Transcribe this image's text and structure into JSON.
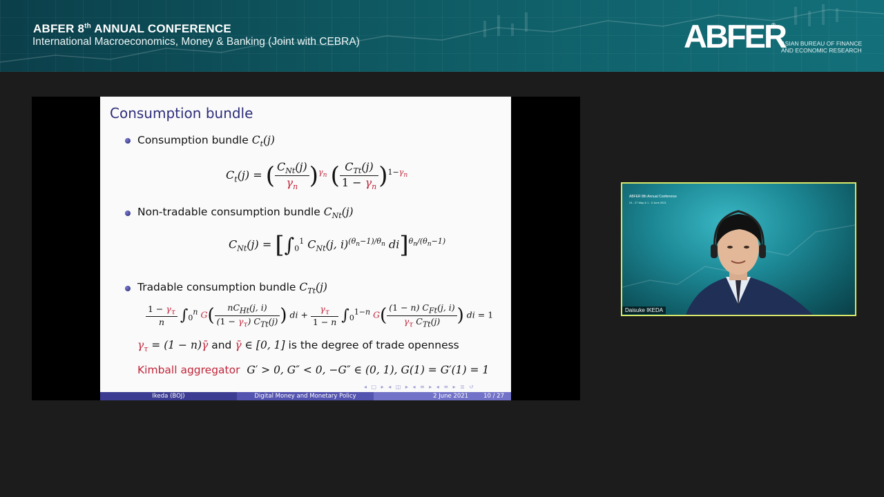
{
  "banner": {
    "conference_title": "ABFER 8",
    "conference_title_sup": "th",
    "conference_title_rest": " ANNUAL CONFERENCE",
    "session": "International Macroeconomics, Money & Banking (Joint with CEBRA)",
    "logo_text": "ABFER",
    "logo_reg": "®",
    "logo_line1": "ASIAN BUREAU OF FINANCE",
    "logo_line2": "AND ECONOMIC RESEARCH"
  },
  "slide": {
    "title": "Consumption bundle",
    "bullet1": "Consumption bundle",
    "bullet2": "Non-tradable consumption bundle",
    "bullet3": "Tradable consumption bundle",
    "openness_text": "is the degree of trade openness",
    "and_text": "and",
    "kimball_label": "Kimball aggregator",
    "footer": {
      "author": "Ikeda (BOJ)",
      "talk_title": "Digital Money and Monetary Policy",
      "date": "2 June 2021",
      "page": "10 / 27"
    }
  },
  "webcam": {
    "conference_title": "ABFER 8th Annual Conference",
    "conference_dates": "24 - 27 May & 1 - 3 June 2021",
    "speaker_name": "Daisuke IKEDA"
  }
}
